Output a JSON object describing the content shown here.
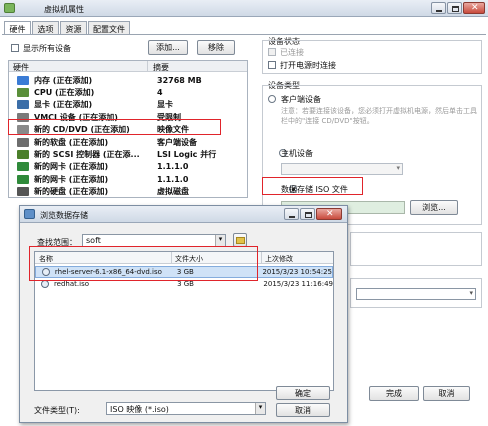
{
  "main_window": {
    "title": "虚拟机属性",
    "tabs": [
      "硬件",
      "选项",
      "资源",
      "配置文件"
    ],
    "show_all_devices": "显示所有设备",
    "add_button": "添加...",
    "remove_button": "移除",
    "table_headers": {
      "hardware": "硬件",
      "summary": "摘要"
    },
    "hardware_rows": [
      {
        "name": "内存 (正在添加)",
        "summary": "32768 MB",
        "icon_color": "#3a7bd5"
      },
      {
        "name": "CPU (正在添加)",
        "summary": "4",
        "icon_color": "#5a8f3a"
      },
      {
        "name": "显卡 (正在添加)",
        "summary": "显卡",
        "icon_color": "#3b6ea8"
      },
      {
        "name": "VMCI 设备 (正在添加)",
        "summary": "受限制",
        "icon_color": "#7a7a7a"
      },
      {
        "name": "新的 CD/DVD (正在添加)",
        "summary": "映像文件",
        "icon_color": "#8a8a8a"
      },
      {
        "name": "新的软盘 (正在添加)",
        "summary": "客户端设备",
        "icon_color": "#6d6d6d"
      },
      {
        "name": "新的 SCSI 控制器 (正在添...",
        "summary": "LSI Logic 并行",
        "icon_color": "#4b7f2a"
      },
      {
        "name": "新的网卡 (正在添加)",
        "summary": "1.1.1.0",
        "icon_color": "#2f8a3a"
      },
      {
        "name": "新的网卡 (正在添加)",
        "summary": "1.1.1.0",
        "icon_color": "#2f8a3a"
      },
      {
        "name": "新的硬盘 (正在添加)",
        "summary": "虚拟磁盘",
        "icon_color": "#555555"
      }
    ],
    "device_status": {
      "label": "设备状态",
      "connected": "已连接",
      "connect_at_power_on": "打开电源时连接"
    },
    "device_type": {
      "label": "设备类型",
      "client_device": "客户端设备",
      "note": "注意：若要连接该设备，您必须打开虚拟机电源，然后单击工具栏中的\"连接 CD/DVD\"按钮。",
      "host_device": "主机设备",
      "datastore_iso": "数据存储 ISO 文件",
      "browse_button": "浏览..."
    },
    "finish_button": "完成",
    "cancel_button": "取消"
  },
  "browse_dialog": {
    "title": "浏览数据存储",
    "lookin_label": "查找范围：",
    "lookin_value": "soft",
    "columns": {
      "name": "名称",
      "size": "文件大小",
      "modified": "上次修改"
    },
    "files": [
      {
        "name": "rhel-server-6.1-x86_64-dvd.iso",
        "size": "3 GB",
        "modified": "2015/3/23 10:54:25",
        "selected": true
      },
      {
        "name": "redhat.iso",
        "size": "3 GB",
        "modified": "2015/3/23 11:16:49",
        "selected": false
      }
    ],
    "filetype_label": "文件类型(T):",
    "filetype_value": "ISO 映像 (*.iso)",
    "ok_button": "确定",
    "cancel_button": "取消"
  }
}
